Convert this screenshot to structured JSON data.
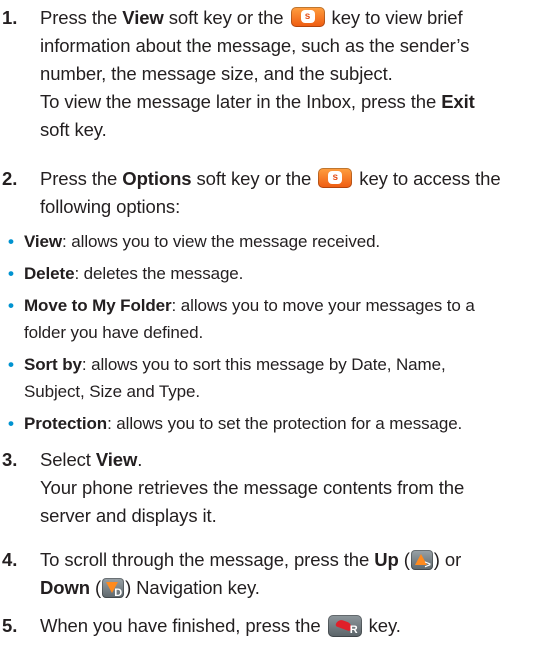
{
  "step1": {
    "num": "1.",
    "l1_a": "Press the ",
    "l1_b": "View",
    "l1_c": " soft key or the ",
    "l1_d": " key to view brief",
    "l2": "information about the message, such as the sender’s",
    "l3": "number, the message size, and the subject.",
    "l4_a": "To view the message later in the Inbox, press the ",
    "l4_b": "Exit",
    "l5": "soft key."
  },
  "step2": {
    "num": "2.",
    "l1_a": "Press the ",
    "l1_b": "Options",
    "l1_c": " soft key or the ",
    "l1_d": " key to access the",
    "l2": "following options:"
  },
  "bullets": [
    {
      "term": "View",
      "desc": ": allows you to view the message received.",
      "cont": ""
    },
    {
      "term": "Delete",
      "desc": ": deletes the message.",
      "cont": ""
    },
    {
      "term": "Move to My Folder",
      "desc": ": allows you to move your messages to a",
      "cont": "folder you have defined."
    },
    {
      "term": "Sort by",
      "desc": ": allows you to sort this message by Date, Name,",
      "cont": "Subject, Size and Type."
    },
    {
      "term": "Protection",
      "desc": ": allows you to set the protection for a message.",
      "cont": ""
    }
  ],
  "bullet_symbol": "•",
  "step3": {
    "num": "3.",
    "l1_a": "Select ",
    "l1_b": "View",
    "l1_c": ".",
    "l2": "Your phone retrieves the message contents from the",
    "l3": "server and displays it."
  },
  "step4": {
    "num": "4.",
    "l1_a": "To scroll through the message, press the ",
    "l1_b": "Up",
    "l1_c": " (",
    "l1_d": ") or",
    "l2_a": "Down",
    "l2_b": " (",
    "l2_c": ") Navigation key."
  },
  "step5": {
    "num": "5.",
    "l1_a": "When you have finished, press the ",
    "l1_b": " key."
  },
  "colors": {
    "text": "#231f20",
    "bullet": "#0093d0",
    "softkey": "#ee5a10",
    "navkey": "#ff8a1e",
    "endkey": "#e0202a"
  },
  "icons": {
    "softkey": "orange-soft-key-icon",
    "up": "up-navigation-key-icon",
    "down": "down-navigation-key-icon",
    "end": "end-key-icon"
  }
}
